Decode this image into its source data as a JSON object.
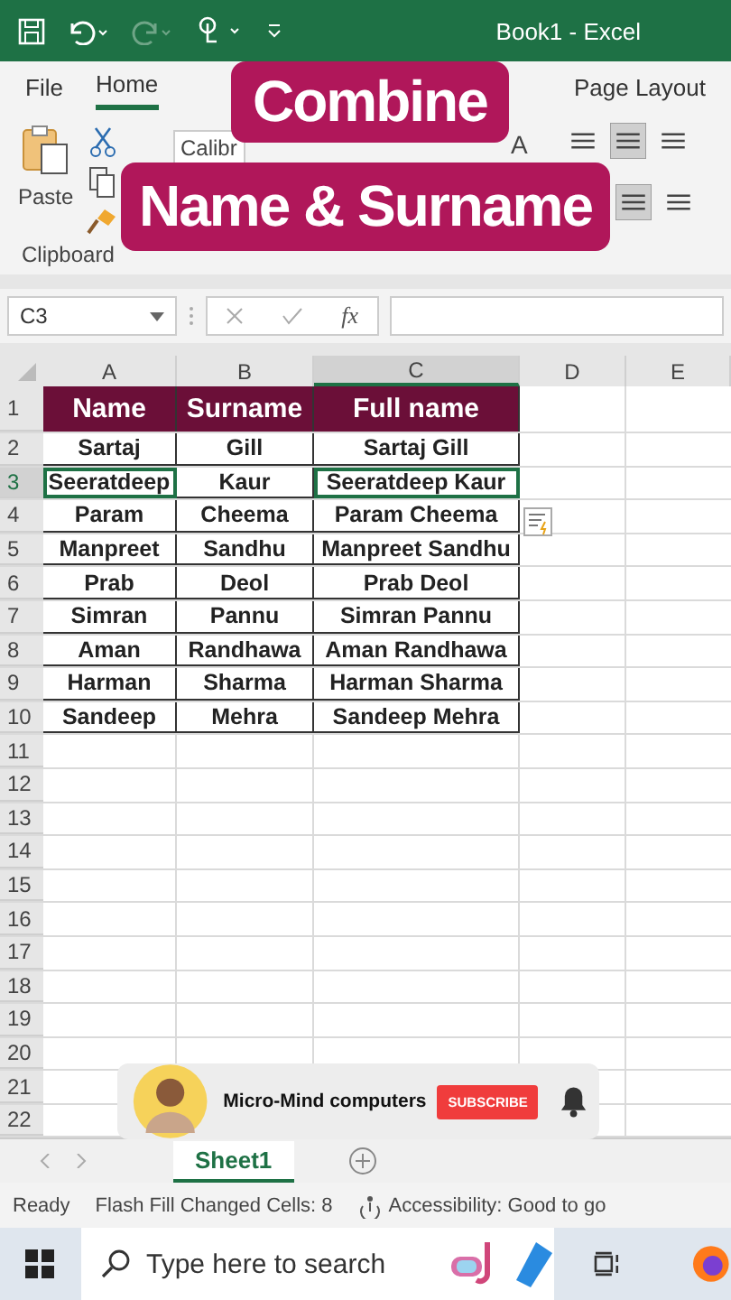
{
  "title_bar": {
    "title": "Book1  -  Excel"
  },
  "ribbon_tabs": [
    {
      "label": "File",
      "selected": false
    },
    {
      "label": "Home",
      "selected": true
    },
    {
      "label": "Page Layout",
      "selected": false
    }
  ],
  "ribbon": {
    "paste_label": "Paste",
    "group_label": "Clipboard",
    "font_box": "Calibr",
    "font_grow": "A"
  },
  "video_title": [
    "Combine",
    "Name & Surname"
  ],
  "formula_bar": {
    "name_box": "C3",
    "function_symbol": "fx"
  },
  "columns": [
    {
      "label": "A",
      "selected": false
    },
    {
      "label": "B",
      "selected": false
    },
    {
      "label": "C",
      "selected": true
    },
    {
      "label": "D",
      "selected": false
    },
    {
      "label": "E",
      "selected": false
    }
  ],
  "rows": [
    {
      "number": "1",
      "selected": false,
      "kind": "header",
      "cells": [
        {
          "text": "Name",
          "selected": false
        },
        {
          "text": "Surname",
          "selected": false
        },
        {
          "text": "Full name",
          "selected": false
        }
      ]
    },
    {
      "number": "2",
      "selected": false,
      "kind": "data",
      "cells": [
        {
          "text": "Sartaj",
          "selected": false
        },
        {
          "text": "Gill",
          "selected": false
        },
        {
          "text": "Sartaj Gill",
          "selected": false
        }
      ]
    },
    {
      "number": "3",
      "selected": true,
      "kind": "data",
      "cells": [
        {
          "text": "Seeratdeep",
          "selected": true
        },
        {
          "text": "Kaur",
          "selected": false
        },
        {
          "text": "Seeratdeep Kaur",
          "selected": true
        }
      ]
    },
    {
      "number": "4",
      "selected": false,
      "kind": "data",
      "cells": [
        {
          "text": "Param",
          "selected": false
        },
        {
          "text": "Cheema",
          "selected": false
        },
        {
          "text": "Param Cheema",
          "selected": false
        }
      ]
    },
    {
      "number": "5",
      "selected": false,
      "kind": "data",
      "cells": [
        {
          "text": "Manpreet",
          "selected": false
        },
        {
          "text": "Sandhu",
          "selected": false
        },
        {
          "text": "Manpreet Sandhu",
          "selected": false
        }
      ]
    },
    {
      "number": "6",
      "selected": false,
      "kind": "data",
      "cells": [
        {
          "text": "Prab",
          "selected": false
        },
        {
          "text": "Deol",
          "selected": false
        },
        {
          "text": "Prab Deol",
          "selected": false
        }
      ]
    },
    {
      "number": "7",
      "selected": false,
      "kind": "data",
      "cells": [
        {
          "text": "Simran",
          "selected": false
        },
        {
          "text": "Pannu",
          "selected": false
        },
        {
          "text": "Simran Pannu",
          "selected": false
        }
      ]
    },
    {
      "number": "8",
      "selected": false,
      "kind": "data",
      "cells": [
        {
          "text": "Aman",
          "selected": false
        },
        {
          "text": "Randhawa",
          "selected": false
        },
        {
          "text": "Aman Randhawa",
          "selected": false
        }
      ]
    },
    {
      "number": "9",
      "selected": false,
      "kind": "data",
      "cells": [
        {
          "text": "Harman",
          "selected": false
        },
        {
          "text": "Sharma",
          "selected": false
        },
        {
          "text": "Harman Sharma",
          "selected": false
        }
      ]
    },
    {
      "number": "10",
      "selected": false,
      "kind": "data",
      "cells": [
        {
          "text": "Sandeep",
          "selected": false
        },
        {
          "text": "Mehra",
          "selected": false
        },
        {
          "text": "Sandeep Mehra",
          "selected": false
        }
      ]
    },
    {
      "number": "11",
      "selected": false,
      "kind": "empty"
    },
    {
      "number": "12",
      "selected": false,
      "kind": "empty"
    },
    {
      "number": "13",
      "selected": false,
      "kind": "empty"
    },
    {
      "number": "14",
      "selected": false,
      "kind": "empty"
    },
    {
      "number": "15",
      "selected": false,
      "kind": "empty"
    },
    {
      "number": "16",
      "selected": false,
      "kind": "empty"
    },
    {
      "number": "17",
      "selected": false,
      "kind": "empty"
    },
    {
      "number": "18",
      "selected": false,
      "kind": "empty"
    },
    {
      "number": "19",
      "selected": false,
      "kind": "empty"
    },
    {
      "number": "20",
      "selected": false,
      "kind": "empty"
    },
    {
      "number": "21",
      "selected": false,
      "kind": "empty"
    },
    {
      "number": "22",
      "selected": false,
      "kind": "empty"
    }
  ],
  "sheet_tabs": [
    {
      "label": "Sheet1",
      "selected": true
    }
  ],
  "status_bar": {
    "mode": "Ready",
    "flash_fill": "Flash Fill Changed Cells: 8",
    "accessibility": "Accessibility: Good to go"
  },
  "taskbar": {
    "search_placeholder": "Type here to search"
  },
  "channel_banner": {
    "channel": "Micro-Mind computers",
    "button": "SUBSCRIBE"
  }
}
